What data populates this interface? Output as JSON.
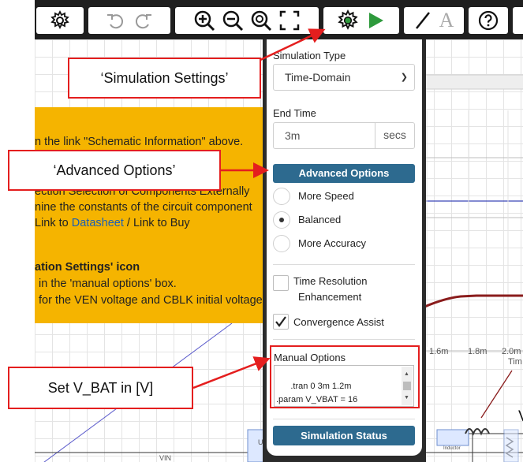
{
  "info_panel": {
    "line1": "n the link \"Schematic Information\" above.",
    "line2": "ection Selection of Components Externally",
    "line3": "nine the constants of the circuit component",
    "line4_pre": "Link to ",
    "line4_link": "Datasheet",
    "line4_post": " / Link to Buy",
    "line5": "ation Settings' icon",
    "line6": "in the 'manual options' box.",
    "line7": "for the VEN voltage and CBLK initial voltage"
  },
  "settings_panel": {
    "sim_type_label": "Simulation Type",
    "sim_type_value": "Time-Domain",
    "end_time_label": "End Time",
    "end_time_value": "3m",
    "end_time_unit": "secs",
    "advanced_button": "Advanced Options",
    "options": [
      {
        "label": "More Speed",
        "selected": false
      },
      {
        "label": "Balanced",
        "selected": true
      },
      {
        "label": "More Accuracy",
        "selected": false
      }
    ],
    "time_res_label_1": "Time Resolution",
    "time_res_label_2": "Enhancement",
    "convergence_label": "Convergence Assist",
    "manual_options_label": "Manual Options",
    "manual_options_text": ".tran 0 3m 1.2m\n.param V_VBAT = 16",
    "status_button": "Simulation Status"
  },
  "callouts": {
    "sim_settings": "‘Simulation Settings’",
    "advanced_options": "‘Advanced Options’",
    "set_vbat": "Set V_BAT in [V]"
  },
  "graph": {
    "tick1": "1.6m",
    "tick2": "1.8m",
    "tick3": "2.0m",
    "tick4": "Tim"
  },
  "schematic": {
    "label_vin": "VIN",
    "label_u1": "U1",
    "label_inductor": "Inductor",
    "label_v": "V",
    "label_u": "u"
  },
  "colors": {
    "accent_red": "#e41e1e",
    "info_bg": "#f5b400",
    "button_blue": "#2d6a8f",
    "play_green": "#2e9a3c"
  },
  "icons": [
    "gear-icon",
    "undo-icon",
    "redo-icon",
    "zoom-in-icon",
    "zoom-out-icon",
    "zoom-fit-icon",
    "fullscreen-icon",
    "simulation-settings-icon",
    "run-icon",
    "wire-icon",
    "text-icon",
    "help-icon"
  ]
}
